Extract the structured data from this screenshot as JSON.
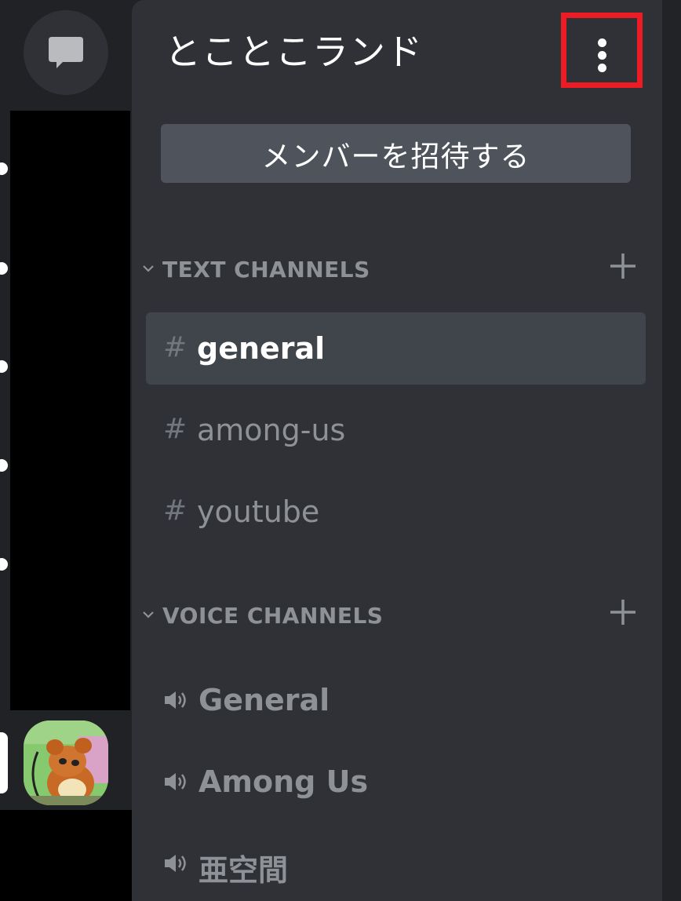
{
  "server": {
    "name": "とことこランド",
    "invite_label": "メンバーを招待する"
  },
  "categories": [
    {
      "label": "TEXT CHANNELS",
      "channels": [
        {
          "prefix": "#",
          "name": "general",
          "active": true
        },
        {
          "prefix": "#",
          "name": "among-us",
          "active": false
        },
        {
          "prefix": "#",
          "name": "youtube",
          "active": false
        }
      ]
    },
    {
      "label": "VOICE CHANNELS",
      "channels": [
        {
          "name": "General"
        },
        {
          "name": "Among Us"
        },
        {
          "name": "亜空間"
        }
      ]
    }
  ],
  "colors": {
    "highlight_border": "#ed1c24",
    "panel_bg": "#2f3136",
    "rail_bg": "#202225",
    "button_bg": "#4f545c"
  },
  "icons": [
    "chat-bubble-icon",
    "more-vertical-icon",
    "chevron-down-icon",
    "plus-icon",
    "hash-icon",
    "speaker-icon"
  ]
}
